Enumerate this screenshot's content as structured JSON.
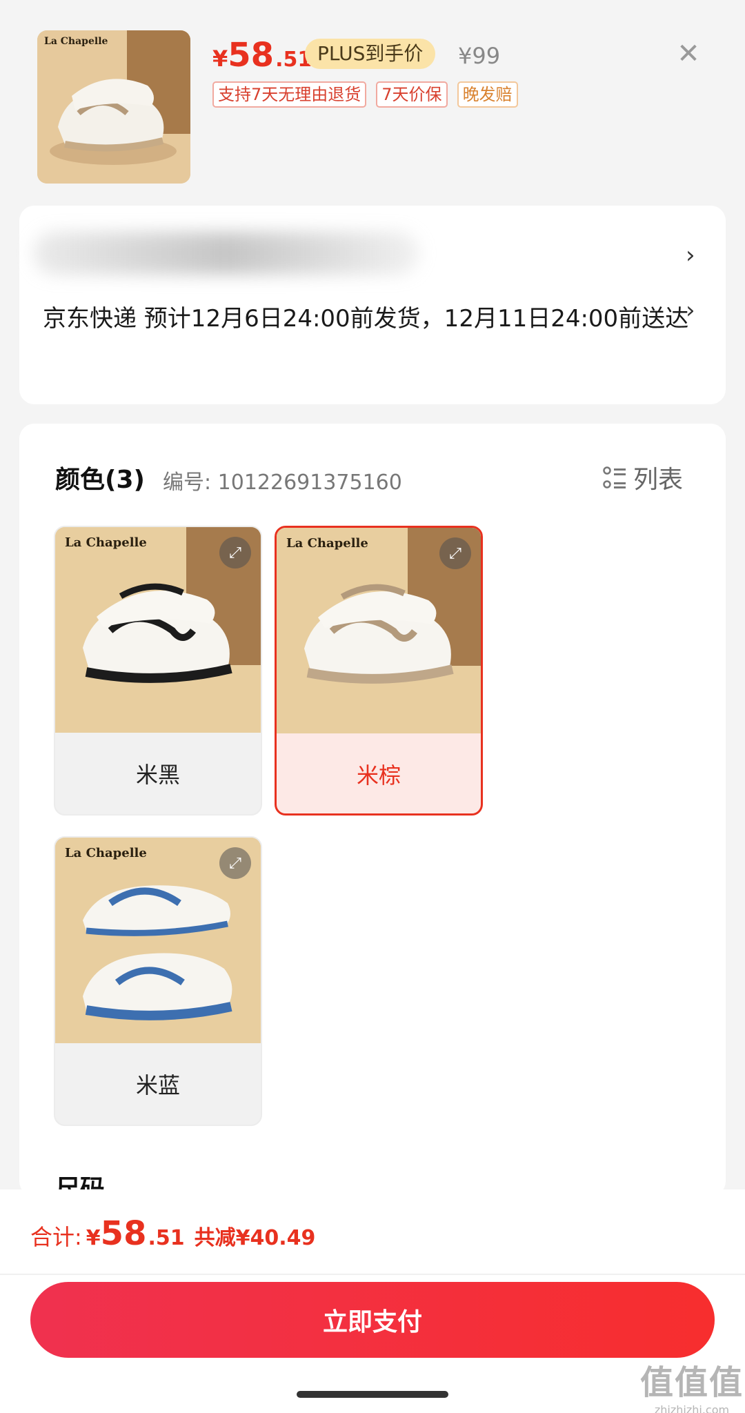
{
  "header": {
    "thumb_brand": "La Chapelle",
    "price": {
      "currency": "¥",
      "integer": "58",
      "decimal": ".51"
    },
    "plus_badge": "PLUS到手价",
    "original_price": "¥99",
    "close_icon": "close-icon",
    "tags": [
      "支持7天无理由退货",
      "7天价保",
      "晚发赔"
    ]
  },
  "delivery": {
    "text": "京东快递 预计12月6日24:00前发货，12月11日24:00前送达"
  },
  "spec": {
    "title": "颜色(3)",
    "code": "编号: 10122691375160",
    "list_label": "列表",
    "options": [
      {
        "brand": "La Chapelle",
        "label": "米黑",
        "accent": "#1a1a1a",
        "selected": false
      },
      {
        "brand": "La Chapelle",
        "label": "米棕",
        "accent": "#b39a7c",
        "selected": true
      },
      {
        "brand": "La Chapelle",
        "label": "米蓝",
        "accent": "#3d6fb0",
        "selected": false
      }
    ],
    "size_title": "尺码"
  },
  "footer": {
    "total_label": "合计:",
    "total": {
      "currency": "¥",
      "integer": "58",
      "decimal": ".51"
    },
    "discount": "共减¥40.49",
    "pay_button": "立即支付",
    "watermark": "值值值",
    "watermark_url": "zhizhizhi.com"
  },
  "colors": {
    "accent_red": "#e8311f",
    "plus_gold": "#fbe3a8"
  }
}
